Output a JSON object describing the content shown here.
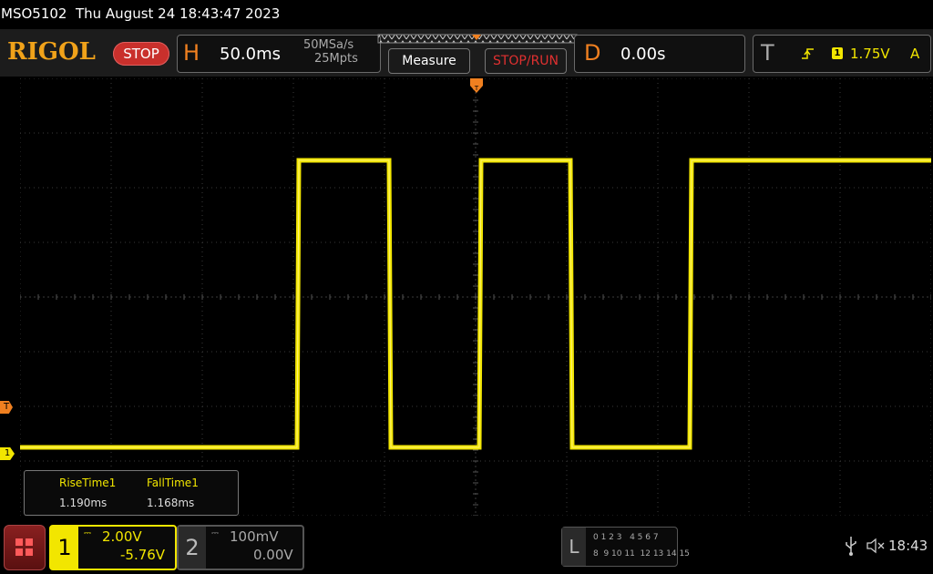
{
  "titlebar": {
    "text": "MSO5102  Thu August 24 18:43:47 2023"
  },
  "logo": "RIGOL",
  "run_state": "STOP",
  "horizontal": {
    "letter": "H",
    "timebase": "50.0ms",
    "sample_rate": "50MSa/s",
    "memory_depth": "25Mpts"
  },
  "buttons": {
    "measure": "Measure",
    "stop_run": "STOP/RUN"
  },
  "delay": {
    "letter": "D",
    "value": "0.00s"
  },
  "trigger": {
    "letter": "T",
    "source": "1",
    "level": "1.75V",
    "mode": "A"
  },
  "markers": {
    "trigger_level": "T",
    "channel1_ground": "1"
  },
  "measurements": [
    {
      "name": "RiseTime1",
      "value": "1.190ms"
    },
    {
      "name": "FallTime1",
      "value": "1.168ms"
    }
  ],
  "channel1": {
    "number": "1",
    "scale": "2.00V",
    "offset": "-5.76V"
  },
  "channel2": {
    "number": "2",
    "scale": "100mV",
    "offset": "0.00V"
  },
  "logic": {
    "letter": "L",
    "row1": "0 1 2 3   4 5 6 7",
    "row2": "8  9 10 11  12 13 14 15"
  },
  "status": {
    "time": "18:43"
  },
  "colors": {
    "channel1": "#f2e600",
    "trigger": "#f08020",
    "stop": "#c9302c",
    "grid": "#3a3a3a"
  },
  "waveform": {
    "type": "square",
    "high_level_div": -2.5,
    "low_level_div": 2.75,
    "transitions_ms": [
      -97.5,
      -47,
      2.5,
      52.5,
      118
    ]
  }
}
